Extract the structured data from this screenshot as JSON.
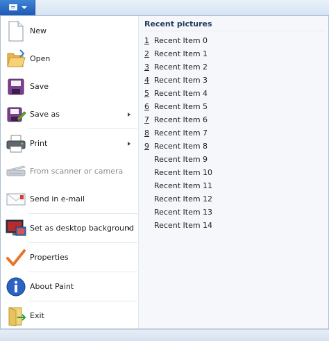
{
  "app_button": {
    "icon": "paint-menu-icon"
  },
  "menu_items": [
    {
      "label": "New",
      "icon": "new-document-icon",
      "has_submenu": false,
      "enabled": true
    },
    {
      "label": "Open",
      "icon": "open-folder-icon",
      "has_submenu": false,
      "enabled": true
    },
    {
      "label": "Save",
      "icon": "save-disk-icon",
      "has_submenu": false,
      "enabled": true
    },
    {
      "label": "Save as",
      "icon": "save-as-icon",
      "has_submenu": true,
      "enabled": true
    },
    {
      "label": "Print",
      "icon": "printer-icon",
      "has_submenu": true,
      "enabled": true
    },
    {
      "label": "From scanner or camera",
      "icon": "scanner-icon",
      "has_submenu": false,
      "enabled": false
    },
    {
      "label": "Send in e-mail",
      "icon": "email-icon",
      "has_submenu": false,
      "enabled": true
    },
    {
      "label": "Set as desktop background",
      "icon": "desktop-background-icon",
      "has_submenu": true,
      "enabled": true
    },
    {
      "label": "Properties",
      "icon": "properties-checkmark-icon",
      "has_submenu": false,
      "enabled": true
    },
    {
      "label": "About Paint",
      "icon": "info-icon",
      "has_submenu": false,
      "enabled": true
    },
    {
      "label": "Exit",
      "icon": "exit-door-icon",
      "has_submenu": false,
      "enabled": true
    }
  ],
  "recent": {
    "title": "Recent pictures",
    "items": [
      {
        "num": "1",
        "name": "Recent Item 0"
      },
      {
        "num": "2",
        "name": "Recent Item 1"
      },
      {
        "num": "3",
        "name": "Recent Item 2"
      },
      {
        "num": "4",
        "name": "Recent Item 3"
      },
      {
        "num": "5",
        "name": "Recent Item 4"
      },
      {
        "num": "6",
        "name": "Recent Item 5"
      },
      {
        "num": "7",
        "name": "Recent Item 6"
      },
      {
        "num": "8",
        "name": "Recent Item 7"
      },
      {
        "num": "9",
        "name": "Recent Item 8"
      },
      {
        "num": "",
        "name": "Recent Item 9"
      },
      {
        "num": "",
        "name": "Recent Item 10"
      },
      {
        "num": "",
        "name": "Recent Item 11"
      },
      {
        "num": "",
        "name": "Recent Item 12"
      },
      {
        "num": "",
        "name": "Recent Item 13"
      },
      {
        "num": "",
        "name": "Recent Item 14"
      }
    ]
  }
}
